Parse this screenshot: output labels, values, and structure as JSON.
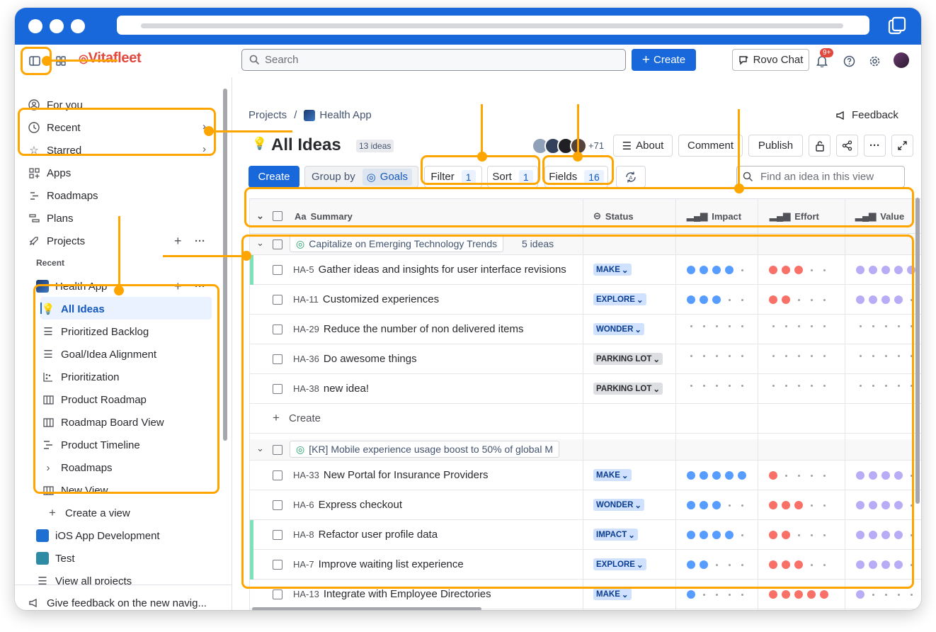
{
  "app": {
    "logo_text": "Vitafleet",
    "search_placeholder": "Search",
    "create_label": "Create",
    "rovo_label": "Rovo Chat",
    "notifications_badge": "9+"
  },
  "sidebar": {
    "top_items": [
      {
        "label": "For you"
      },
      {
        "label": "Recent"
      },
      {
        "label": "Starred"
      },
      {
        "label": "Apps"
      },
      {
        "label": "Roadmaps"
      },
      {
        "label": "Plans"
      },
      {
        "label": "Projects"
      }
    ],
    "recent_header": "Recent",
    "project": "Health App",
    "views": [
      "All Ideas",
      "Prioritized Backlog",
      "Goal/Idea Alignment",
      "Prioritization",
      "Product Roadmap",
      "Roadmap Board View",
      "Product Timeline",
      "Roadmaps",
      "New View"
    ],
    "create_view": "Create a view",
    "other_projects": [
      "iOS App Development",
      "Test"
    ],
    "view_all": "View all projects",
    "feedback": "Give feedback on the new navig..."
  },
  "breadcrumb": {
    "root": "Projects",
    "separator": "/",
    "project": "Health App"
  },
  "header": {
    "feedback": "Feedback",
    "title": "All Ideas",
    "count_badge": "13 ideas",
    "avatars_more": "+71",
    "about": "About",
    "comment": "Comment",
    "publish": "Publish"
  },
  "toolbar": {
    "create": "Create",
    "group_by": "Group by",
    "group_value": "Goals",
    "filter": "Filter",
    "filter_count": "1",
    "sort": "Sort",
    "sort_count": "1",
    "fields": "Fields",
    "fields_count": "16",
    "find_placeholder": "Find an idea in this view"
  },
  "columns": {
    "summary": "Summary",
    "summary_prefix": "Aa",
    "status": "Status",
    "impact": "Impact",
    "effort": "Effort",
    "value": "Value"
  },
  "groups": [
    {
      "title": "Capitalize on Emerging Technology Trends",
      "count": "5 ideas",
      "rows": [
        {
          "key": "HA-5",
          "summary": "Gather ideas and insights for user interface revisions",
          "status": "MAKE",
          "status_color": "blue",
          "impact": 4,
          "effort": 3,
          "value": 5,
          "accent": true
        },
        {
          "key": "HA-11",
          "summary": "Customized experiences",
          "status": "EXPLORE",
          "status_color": "blue",
          "impact": 3,
          "effort": 2,
          "value": 4,
          "accent": false
        },
        {
          "key": "HA-29",
          "summary": "Reduce the number of non delivered items",
          "status": "WONDER",
          "status_color": "blue",
          "impact": 0,
          "effort": 0,
          "value": 0,
          "accent": false
        },
        {
          "key": "HA-36",
          "summary": "Do awesome things",
          "status": "PARKING LOT",
          "status_color": "gray",
          "impact": 0,
          "effort": 0,
          "value": 0,
          "accent": false
        },
        {
          "key": "HA-38",
          "summary": "new idea!",
          "status": "PARKING LOT",
          "status_color": "gray",
          "impact": 0,
          "effort": 0,
          "value": 0,
          "accent": false
        }
      ],
      "create_label": "Create"
    },
    {
      "title": "[KR] Mobile experience usage boost to 50% of global M",
      "count": "",
      "rows": [
        {
          "key": "HA-33",
          "summary": "New Portal for Insurance Providers",
          "status": "MAKE",
          "status_color": "blue",
          "impact": 5,
          "effort": 1,
          "value": 4,
          "accent": false
        },
        {
          "key": "HA-6",
          "summary": "Express checkout",
          "status": "WONDER",
          "status_color": "blue",
          "impact": 3,
          "effort": 3,
          "value": 4,
          "accent": false
        },
        {
          "key": "HA-8",
          "summary": "Refactor user profile data",
          "status": "IMPACT",
          "status_color": "blue",
          "impact": 4,
          "effort": 2,
          "value": 4,
          "accent": true
        },
        {
          "key": "HA-7",
          "summary": "Improve waiting list experience",
          "status": "EXPLORE",
          "status_color": "blue",
          "impact": 2,
          "effort": 3,
          "value": 4,
          "accent": true
        },
        {
          "key": "HA-13",
          "summary": "Integrate with Employee Directories",
          "status": "MAKE",
          "status_color": "blue",
          "impact": 1,
          "effort": 5,
          "value": 1,
          "accent": false
        }
      ]
    }
  ],
  "colors": {
    "brand": "#1868DB",
    "annotation": "#FFA500",
    "impact": "#579DFF",
    "effort": "#F87168",
    "value": "#B8ACF6"
  }
}
